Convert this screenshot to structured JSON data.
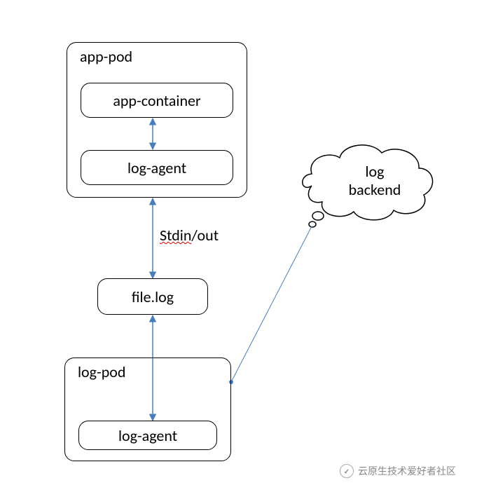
{
  "nodes": {
    "app_pod": {
      "label": "app-pod"
    },
    "app_container": {
      "label": "app-container"
    },
    "log_agent_top": {
      "label": "log-agent"
    },
    "file_log": {
      "label": "file.log"
    },
    "log_pod": {
      "label": "log-pod"
    },
    "log_agent_bottom": {
      "label": "log-agent"
    },
    "log_backend": {
      "line1": "log",
      "line2": "backend"
    }
  },
  "edges": {
    "stdin_out": {
      "part1": "Stdin",
      "part2": "/out"
    }
  },
  "watermark": {
    "text": "云原生技术爱好者社区",
    "icon": "✓"
  }
}
